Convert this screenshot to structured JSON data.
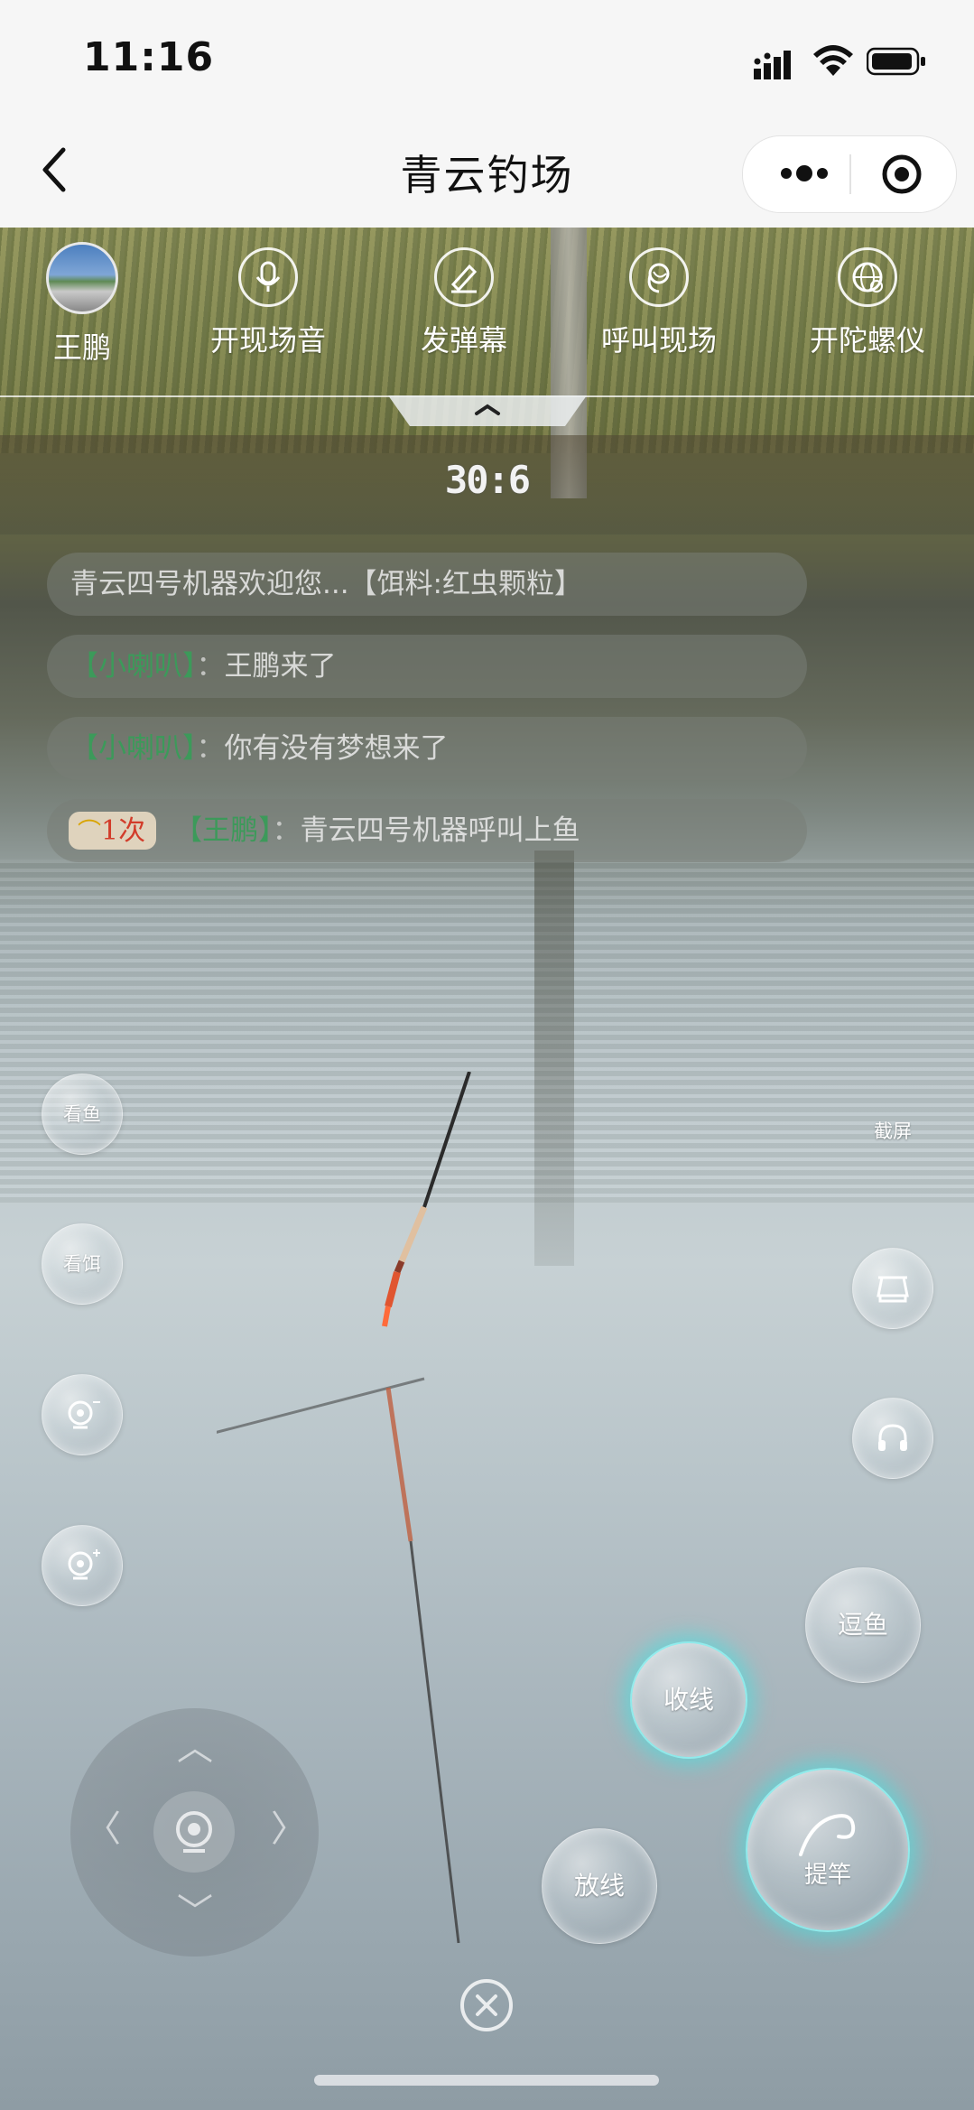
{
  "status_bar": {
    "time": "11:16"
  },
  "nav": {
    "title": "青云钓场"
  },
  "toolbar": [
    {
      "label": "王鹏",
      "icon": "user-avatar"
    },
    {
      "label": "开现场音",
      "icon": "microphone-icon"
    },
    {
      "label": "发弹幕",
      "icon": "pencil-icon"
    },
    {
      "label": "呼叫现场",
      "icon": "call-icon"
    },
    {
      "label": "开陀螺仪",
      "icon": "gyroscope-globe-icon"
    }
  ],
  "countdown": "30:6",
  "chat": {
    "msg1": "青云四号机器欢迎您...【饵料:红虫颗粒】",
    "msg2": {
      "name": "【小喇叭】",
      "colon": "：",
      "text": "王鹏来了"
    },
    "msg3": {
      "name": "【小喇叭】",
      "colon": "：",
      "text": "你有没有梦想来了"
    },
    "msg4": {
      "badge": "1次",
      "name": "【王鹏】",
      "colon": "：",
      "text": "青云四号机器呼叫上鱼"
    }
  },
  "left_controls": {
    "look_fish": "看鱼",
    "look_bait": "看饵",
    "cam_minus": "camera-minus-icon",
    "cam_plus": "camera-plus-icon"
  },
  "right_controls": {
    "screenshot": "截屏",
    "scale": "scale-icon",
    "headset": "headset-icon",
    "tease_fish": "逗鱼"
  },
  "actions": {
    "reel_in": "收线",
    "release_line": "放线",
    "lift_rod": "提竿"
  },
  "colors": {
    "accent_glow": "#50dcdc",
    "name_green": "#3c9a5a",
    "badge_red": "#d23c2a"
  }
}
